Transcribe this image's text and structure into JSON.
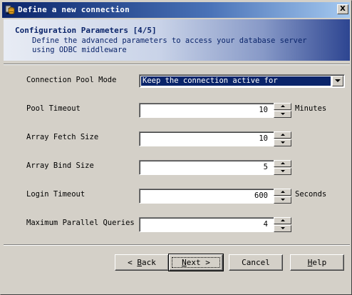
{
  "window": {
    "title": "Define a new connection",
    "close_glyph": "X"
  },
  "header": {
    "title": "Configuration Parameters [4/5]",
    "description": "Define the advanced parameters to access your database server\nusing ODBC middleware"
  },
  "fields": {
    "pool_mode": {
      "label": "Connection Pool Mode",
      "value": "Keep the connection active for"
    },
    "pool_timeout": {
      "label": "Pool Timeout",
      "value": "10",
      "unit": "Minutes"
    },
    "array_fetch_size": {
      "label": "Array Fetch Size",
      "value": "10"
    },
    "array_bind_size": {
      "label": "Array Bind Size",
      "value": "5"
    },
    "login_timeout": {
      "label": "Login Timeout",
      "value": "600",
      "unit": "Seconds"
    },
    "max_parallel_queries": {
      "label": "Maximum Parallel Queries",
      "value": "4"
    }
  },
  "buttons": {
    "back": {
      "arrow": "<",
      "label_accel": "B",
      "label_rest": "ack"
    },
    "next": {
      "label_accel": "N",
      "label_rest": "ext",
      "arrow": ">"
    },
    "cancel": {
      "label": "Cancel"
    },
    "help": {
      "label_accel": "H",
      "label_rest": "elp"
    }
  },
  "icons": {
    "title_icon": "database-connection-icon",
    "close_icon": "close-icon",
    "dropdown_icon": "chevron-down-icon",
    "spin_up_icon": "spin-up-icon",
    "spin_down_icon": "spin-down-icon"
  },
  "colors": {
    "titlebar_start": "#0a246a",
    "titlebar_end": "#a6caf0",
    "dialog_face": "#d4d0c8",
    "selection": "#0a246a"
  }
}
